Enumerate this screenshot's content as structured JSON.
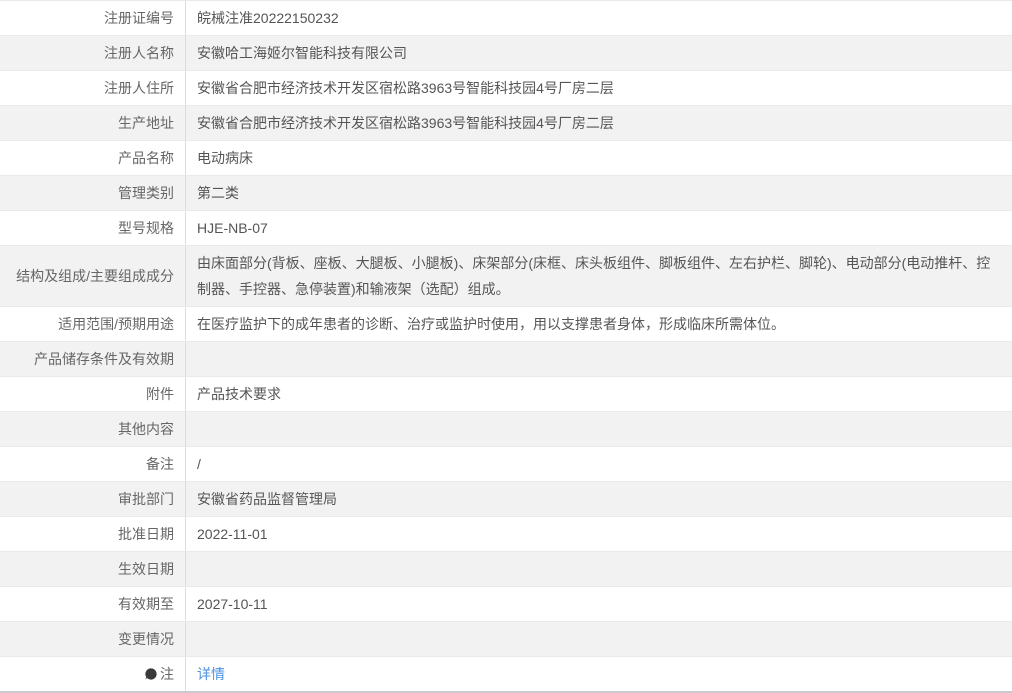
{
  "colors": {
    "link": "#4a90e2",
    "row_alt_background": "#f2f2f2",
    "row_border": "#e9e9e9",
    "table_bottom_border": "#c9c9cf",
    "label_text": "#666666",
    "value_text": "#555555"
  },
  "icons": {
    "note_icon": "speech-bubble-icon"
  },
  "rows": [
    {
      "label": "注册证编号",
      "value": "皖械注准20222150232"
    },
    {
      "label": "注册人名称",
      "value": "安徽哈工海姬尔智能科技有限公司"
    },
    {
      "label": "注册人住所",
      "value": "安徽省合肥市经济技术开发区宿松路3963号智能科技园4号厂房二层"
    },
    {
      "label": "生产地址",
      "value": "安徽省合肥市经济技术开发区宿松路3963号智能科技园4号厂房二层"
    },
    {
      "label": "产品名称",
      "value": "电动病床"
    },
    {
      "label": "管理类别",
      "value": "第二类"
    },
    {
      "label": "型号规格",
      "value": "HJE-NB-07"
    },
    {
      "label": "结构及组成/主要组成成分",
      "value": "由床面部分(背板、座板、大腿板、小腿板)、床架部分(床框、床头板组件、脚板组件、左右护栏、脚轮)、电动部分(电动推杆、控制器、手控器、急停装置)和输液架（选配）组成。"
    },
    {
      "label": "适用范围/预期用途",
      "value": "在医疗监护下的成年患者的诊断、治疗或监护时使用，用以支撑患者身体，形成临床所需体位。"
    },
    {
      "label": "产品储存条件及有效期",
      "value": ""
    },
    {
      "label": "附件",
      "value": "产品技术要求"
    },
    {
      "label": "其他内容",
      "value": ""
    },
    {
      "label": "备注",
      "value": "/"
    },
    {
      "label": "审批部门",
      "value": "安徽省药品监督管理局"
    },
    {
      "label": "批准日期",
      "value": "2022-11-01"
    },
    {
      "label": "生效日期",
      "value": ""
    },
    {
      "label": "有效期至",
      "value": "2027-10-11"
    },
    {
      "label": "变更情况",
      "value": ""
    },
    {
      "label": "注",
      "value": "详情"
    }
  ]
}
